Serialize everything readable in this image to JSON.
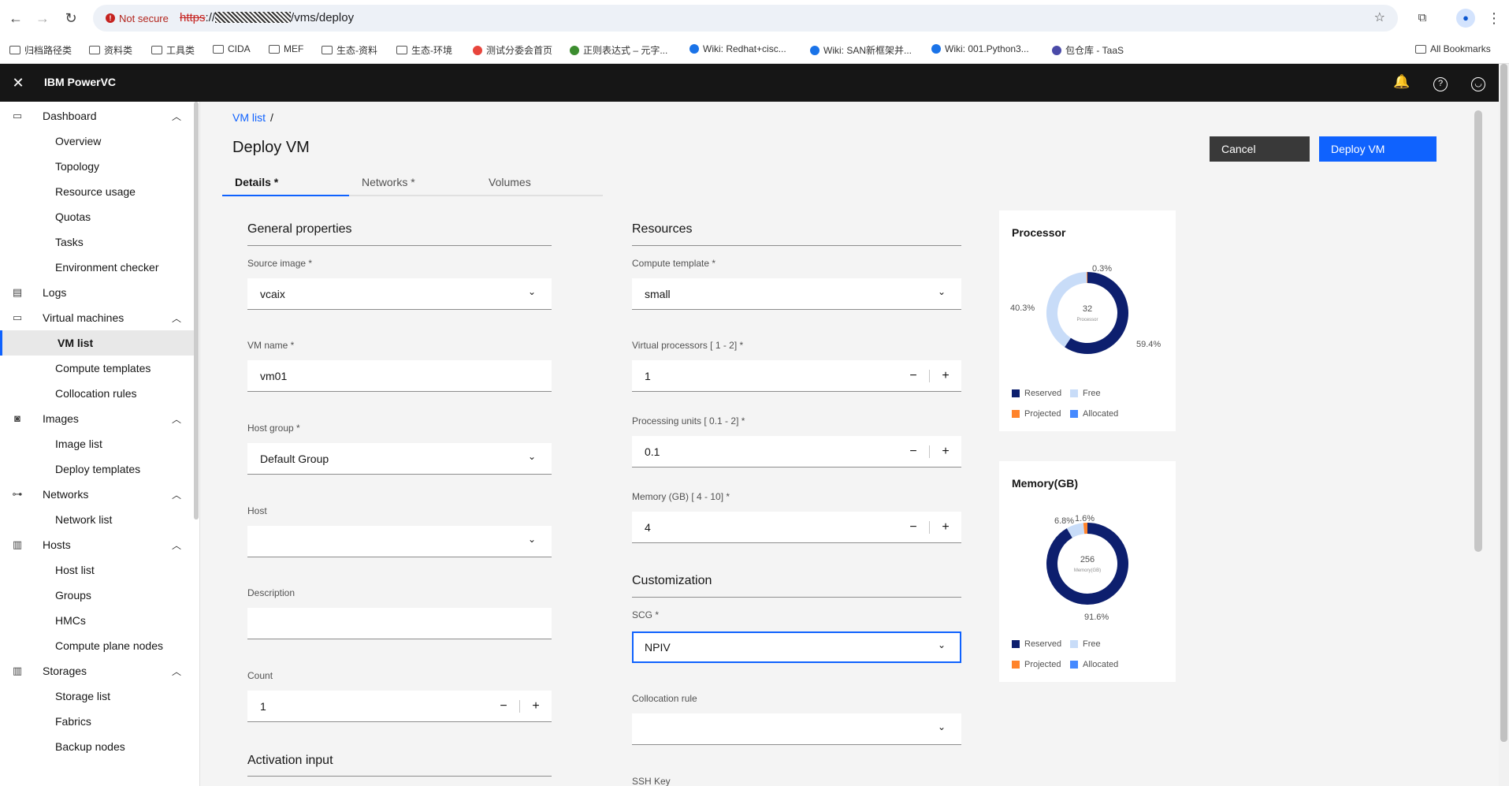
{
  "browser": {
    "not_secure": "Not secure",
    "url_scheme": "https",
    "url_sep": "://",
    "url_path": "/vms/deploy",
    "bookmarks": [
      {
        "label": "归档路径类",
        "kind": "folder"
      },
      {
        "label": "资料类",
        "kind": "folder"
      },
      {
        "label": "工具类",
        "kind": "folder"
      },
      {
        "label": "CIDA",
        "kind": "folder"
      },
      {
        "label": "MEF",
        "kind": "folder"
      },
      {
        "label": "生态-资料",
        "kind": "folder"
      },
      {
        "label": "生态-环境",
        "kind": "folder"
      },
      {
        "label": "测试分委会首页",
        "kind": "site"
      },
      {
        "label": "正则表达式 – 元字...",
        "kind": "site"
      },
      {
        "label": "Wiki: Redhat+cisc...",
        "kind": "site"
      },
      {
        "label": "Wiki: SAN新框架并...",
        "kind": "site"
      },
      {
        "label": "Wiki: 001.Python3...",
        "kind": "site"
      },
      {
        "label": "包仓库 - TaaS",
        "kind": "site"
      }
    ],
    "all_bookmarks": "All Bookmarks"
  },
  "header": {
    "brand": "IBM PowerVC"
  },
  "sidebar": {
    "items": [
      {
        "label": "Dashboard",
        "type": "parent",
        "icon": "monitor-icon"
      },
      {
        "label": "Overview",
        "type": "child"
      },
      {
        "label": "Topology",
        "type": "child"
      },
      {
        "label": "Resource usage",
        "type": "child"
      },
      {
        "label": "Quotas",
        "type": "child"
      },
      {
        "label": "Tasks",
        "type": "child"
      },
      {
        "label": "Environment checker",
        "type": "child"
      },
      {
        "label": "Logs",
        "type": "parent",
        "icon": "document-icon"
      },
      {
        "label": "Virtual machines",
        "type": "parent",
        "icon": "monitor-icon"
      },
      {
        "label": "VM list",
        "type": "child",
        "active": true
      },
      {
        "label": "Compute templates",
        "type": "child"
      },
      {
        "label": "Collocation rules",
        "type": "child"
      },
      {
        "label": "Images",
        "type": "parent",
        "icon": "camera-icon"
      },
      {
        "label": "Image list",
        "type": "child"
      },
      {
        "label": "Deploy templates",
        "type": "child"
      },
      {
        "label": "Networks",
        "type": "parent",
        "icon": "network-icon"
      },
      {
        "label": "Network list",
        "type": "child"
      },
      {
        "label": "Hosts",
        "type": "parent",
        "icon": "server-icon"
      },
      {
        "label": "Host list",
        "type": "child"
      },
      {
        "label": "Groups",
        "type": "child"
      },
      {
        "label": "HMCs",
        "type": "child"
      },
      {
        "label": "Compute plane nodes",
        "type": "child"
      },
      {
        "label": "Storages",
        "type": "parent",
        "icon": "storage-icon"
      },
      {
        "label": "Storage list",
        "type": "child"
      },
      {
        "label": "Fabrics",
        "type": "child"
      },
      {
        "label": "Backup nodes",
        "type": "child"
      }
    ]
  },
  "main": {
    "breadcrumb": "VM list",
    "breadcrumb_sep": "/",
    "title": "Deploy VM",
    "cancel": "Cancel",
    "deploy": "Deploy VM",
    "tabs": [
      "Details *",
      "Networks *",
      "Volumes"
    ],
    "general": {
      "title": "General properties",
      "source_image_label": "Source image *",
      "source_image": "vcaix",
      "vm_name_label": "VM name *",
      "vm_name": "vm01",
      "host_group_label": "Host group *",
      "host_group": "Default Group",
      "host_label": "Host",
      "host": "",
      "description_label": "Description",
      "description": "",
      "count_label": "Count",
      "count": "1",
      "activation_title": "Activation input"
    },
    "resources": {
      "title": "Resources",
      "compute_template_label": "Compute template *",
      "compute_template": "small",
      "vproc_label": "Virtual processors [ 1 - 2] *",
      "vproc": "1",
      "punits_label": "Processing units [ 0.1 - 2] *",
      "punits": "0.1",
      "memory_label": "Memory (GB) [ 4 - 10] *",
      "memory": "4",
      "customization_title": "Customization",
      "scg_label": "SCG *",
      "scg": "NPIV",
      "collocation_label": "Collocation rule",
      "collocation": "",
      "ssh_label": "SSH Key"
    },
    "stepper": {
      "minus": "−",
      "plus": "+"
    }
  },
  "processor_card": {
    "title": "Processor",
    "center_value": "32",
    "center_label": "Processor",
    "pct_labels": {
      "free": "40.3%",
      "projected": "0.3%",
      "reserved": "59.4%"
    },
    "legend": [
      "Reserved",
      "Free",
      "Projected",
      "Allocated"
    ]
  },
  "memory_card": {
    "title": "Memory(GB)",
    "center_value": "256",
    "center_label": "Memory(GB)",
    "pct_labels": {
      "free": "6.8%",
      "projected": "1.6%",
      "reserved": "91.6%"
    },
    "legend": [
      "Reserved",
      "Free",
      "Projected",
      "Allocated"
    ]
  },
  "chart_data": [
    {
      "type": "pie",
      "title": "Processor",
      "categories": [
        "Reserved",
        "Free",
        "Projected"
      ],
      "values": [
        59.4,
        40.3,
        0.3
      ],
      "colors": [
        "#0d1f6e",
        "#c8dcf8",
        "#ff832b"
      ]
    },
    {
      "type": "pie",
      "title": "Memory(GB)",
      "categories": [
        "Reserved",
        "Free",
        "Projected"
      ],
      "values": [
        91.6,
        6.8,
        1.6
      ],
      "colors": [
        "#0d1f6e",
        "#c8dcf8",
        "#ff832b"
      ]
    }
  ],
  "colors": {
    "reserved": "#0d1f6e",
    "free": "#c8dcf8",
    "projected": "#ff832b",
    "allocated": "#4589ff",
    "primary": "#0f62fe",
    "header_bg": "#161616",
    "notification": "#da1e28"
  }
}
